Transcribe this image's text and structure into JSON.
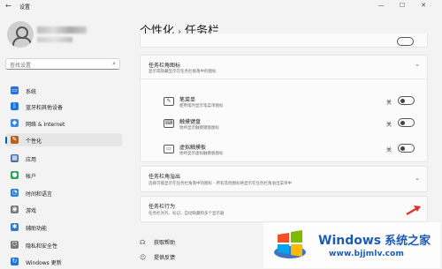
{
  "window": {
    "title": "设置",
    "back_icon": "back-arrow-icon",
    "minimize": "—",
    "maximize": "☐",
    "close": "✕"
  },
  "search": {
    "placeholder": "查找设置",
    "icon": "search-icon"
  },
  "sidebar": {
    "items": [
      {
        "label": "系统",
        "icon": "monitor-icon",
        "color": "#2b6fd6"
      },
      {
        "label": "蓝牙和其他设备",
        "icon": "bluetooth-icon",
        "color": "#1e74d8"
      },
      {
        "label": "网络 & Internet",
        "icon": "wifi-icon",
        "color": "#3a87e6"
      },
      {
        "label": "个性化",
        "icon": "brush-icon",
        "color": "#b0621e",
        "active": true
      },
      {
        "label": "应用",
        "icon": "apps-icon",
        "color": "#4a6fa8"
      },
      {
        "label": "帐户",
        "icon": "account-icon",
        "color": "#2aa05a"
      },
      {
        "label": "时间和语言",
        "icon": "globe-clock-icon",
        "color": "#2b7fd4"
      },
      {
        "label": "游戏",
        "icon": "gamepad-icon",
        "color": "#7a7a7a"
      },
      {
        "label": "辅助功能",
        "icon": "accessibility-icon",
        "color": "#2f7ad1"
      },
      {
        "label": "隐私和安全性",
        "icon": "shield-icon",
        "color": "#7a7a7a"
      },
      {
        "label": "Windows 更新",
        "icon": "update-icon",
        "color": "#1e74d8"
      }
    ]
  },
  "breadcrumb": {
    "parent": "个性化",
    "separator": "›",
    "current": "任务栏"
  },
  "corner_icons_card": {
    "title": "任务栏角图标",
    "subtitle": "显示或隐藏显示在任务栏角落中的图标",
    "items": [
      {
        "title": "笔菜单",
        "desc": "使用笔时显示笔菜单图标",
        "state": "关",
        "on": false,
        "icon": "pen-icon"
      },
      {
        "title": "触摸键盘",
        "desc": "始终显示触摸键盘图标",
        "state": "关",
        "on": false,
        "icon": "keyboard-icon"
      },
      {
        "title": "虚拟触摸板",
        "desc": "始终显示虚拟触摸板图标",
        "state": "关",
        "on": false,
        "icon": "touchpad-icon"
      }
    ]
  },
  "overflow_card": {
    "title": "任务栏角溢出",
    "subtitle": "选择可能显示在任务栏角落中的图标 - 所有其他图标将显示在任务栏角溢出菜单中"
  },
  "behavior_card": {
    "title": "任务栏行为",
    "subtitle": "任务栏对齐、标记、自动隐藏和多个显示器"
  },
  "links": [
    {
      "label": "获取帮助",
      "icon": "help-icon"
    },
    {
      "label": "提供反馈",
      "icon": "feedback-icon"
    }
  ],
  "watermark": {
    "brand": "Windows",
    "brand_cn": "系统之家",
    "url": "www.bjjmlv.com"
  },
  "colors": {
    "accent": "#005fb8",
    "toggle_off_border": "#555555"
  }
}
